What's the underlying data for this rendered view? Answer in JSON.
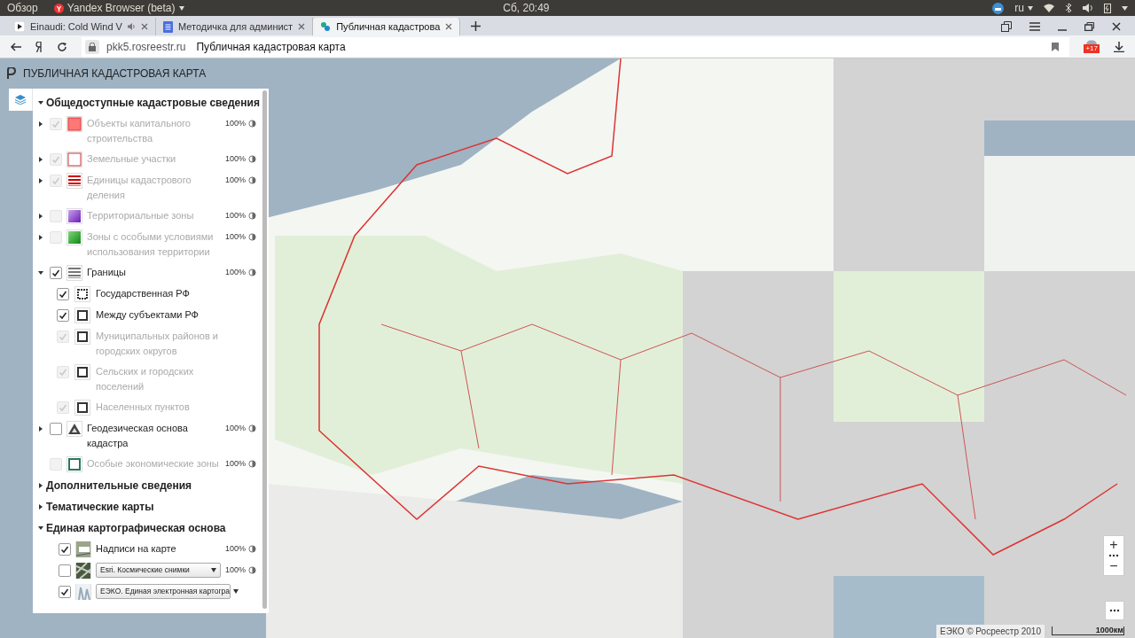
{
  "top_bar": {
    "activities": "Обзор",
    "app": "Yandex Browser (beta)",
    "clock": "Сб, 20:49",
    "language": "ru"
  },
  "tabs": [
    {
      "title": "Einaudi: Cold Wind V",
      "selected": false
    },
    {
      "title": "Методичка для админист",
      "selected": false
    },
    {
      "title": "Публичная кадастрова",
      "selected": true
    }
  ],
  "address_bar": {
    "domain": "pkk5.rosreestr.ru",
    "page_title": "Публичная кадастровая карта",
    "badge": "+17"
  },
  "map": {
    "title": "ПУБЛИЧНАЯ КАДАСТРОВАЯ КАРТА",
    "attribution": "ЕЭКО © Росреестр 2010",
    "scale": "1000км",
    "zoom_in": "+",
    "zoom_out": "−"
  },
  "layers": [
    {
      "title": "Общедоступные кадастровые сведения",
      "expanded": true,
      "items": [
        {
          "kind": "layer",
          "label": "Объекты капитального строительства",
          "checked": true,
          "disabled": true,
          "expanded": false,
          "opacity": "100%"
        },
        {
          "kind": "layer",
          "label": "Земельные участки",
          "checked": true,
          "disabled": true,
          "expanded": false,
          "opacity": "100%"
        },
        {
          "kind": "layer",
          "label": "Единицы кадастрового деления",
          "checked": true,
          "disabled": true,
          "expanded": false,
          "opacity": "100%"
        },
        {
          "kind": "layer",
          "label": "Территориальные зоны",
          "checked": false,
          "disabled": true,
          "expanded": false,
          "opacity": "100%"
        },
        {
          "kind": "layer",
          "label": "Зоны с особыми условиями использования территории",
          "checked": false,
          "disabled": true,
          "expanded": false,
          "opacity": "100%"
        },
        {
          "kind": "layer",
          "label": "Границы",
          "checked": true,
          "disabled": false,
          "expanded": true,
          "opacity": "100%",
          "children": [
            {
              "label": "Государственная РФ",
              "checked": true,
              "disabled": false
            },
            {
              "label": "Между субъектами РФ",
              "checked": true,
              "disabled": false
            },
            {
              "label": "Муниципальных районов и городских округов",
              "checked": true,
              "disabled": true
            },
            {
              "label": "Сельских и городских поселений",
              "checked": true,
              "disabled": true
            },
            {
              "label": "Населенных пунктов",
              "checked": true,
              "disabled": true
            }
          ]
        },
        {
          "kind": "layer",
          "label": "Геодезическая основа кадастра",
          "checked": false,
          "disabled": false,
          "expanded": false,
          "opacity": "100%"
        },
        {
          "kind": "layer",
          "label": "Особые экономические зоны",
          "checked": false,
          "disabled": true,
          "opacity": "100%"
        }
      ]
    },
    {
      "title": "Дополнительные сведения",
      "expanded": false
    },
    {
      "title": "Тематические карты",
      "expanded": false
    },
    {
      "title": "Единая картографическая основа",
      "expanded": true,
      "items": [
        {
          "kind": "layer",
          "label": "Надписи на карте",
          "checked": true,
          "disabled": false,
          "opacity": "100%"
        },
        {
          "kind": "select",
          "value": "Esri. Космические снимки",
          "checked": false,
          "opacity": "100%"
        },
        {
          "kind": "select",
          "value": "ЕЭКО. Единая электронная картогра",
          "checked": true
        }
      ]
    }
  ]
}
